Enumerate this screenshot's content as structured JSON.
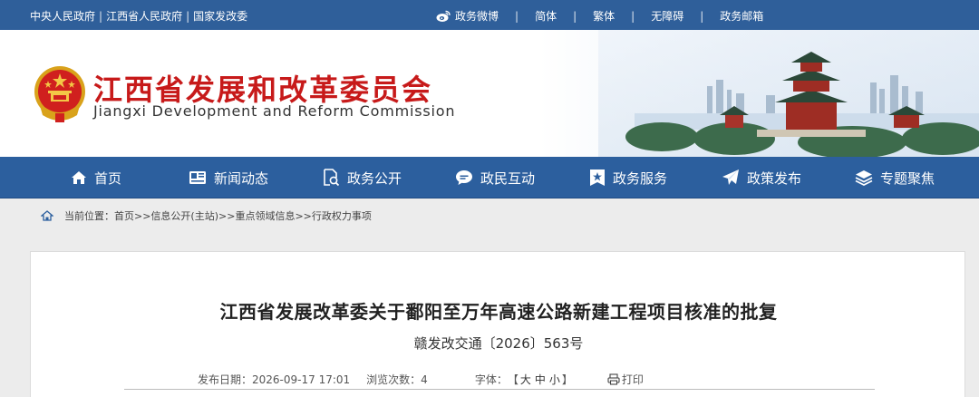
{
  "topbar": {
    "links": [
      "中央人民政府",
      "江西省人民政府",
      "国家发改委"
    ],
    "separator": "|",
    "right_items": [
      {
        "label": "政务微博",
        "icon": "weibo-icon"
      },
      {
        "label": "简体"
      },
      {
        "label": "繁体"
      },
      {
        "label": "无障碍"
      },
      {
        "label": "政务邮箱"
      }
    ]
  },
  "header": {
    "title": "江西省发展和改革委员会",
    "subtitle": "Jiangxi Development and Reform Commission"
  },
  "nav": {
    "items": [
      {
        "label": "首页",
        "icon": "home-icon"
      },
      {
        "label": "新闻动态",
        "icon": "news-icon"
      },
      {
        "label": "政务公开",
        "icon": "document-search-icon"
      },
      {
        "label": "政民互动",
        "icon": "chat-bubble-icon"
      },
      {
        "label": "政务服务",
        "icon": "service-star-icon"
      },
      {
        "label": "政策发布",
        "icon": "paper-plane-icon"
      },
      {
        "label": "专题聚焦",
        "icon": "layers-icon"
      }
    ]
  },
  "breadcrumb": {
    "prefix": "当前位置：",
    "items": [
      "首页",
      "信息公开(主站)",
      "重点领域信息",
      "行政权力事项"
    ],
    "separator": ">>"
  },
  "article": {
    "title": "江西省发展改革委关于鄱阳至万年高速公路新建工程项目核准的批复",
    "doc_number": "赣发改交通〔2026〕563号",
    "publish_label": "发布日期：",
    "publish_date": "2026-09-17 17:01",
    "views_label": "浏览次数：",
    "views": "4",
    "font_label": "字体：",
    "font_open": "【",
    "font_sizes": [
      "大",
      "中",
      "小"
    ],
    "font_close": "】",
    "print_label": "打印"
  },
  "colors": {
    "topbar_bg": "#2f5f9a",
    "nav_bg": "#2c5f9e",
    "title_red": "#c71a1a",
    "page_bg": "#ececec"
  }
}
